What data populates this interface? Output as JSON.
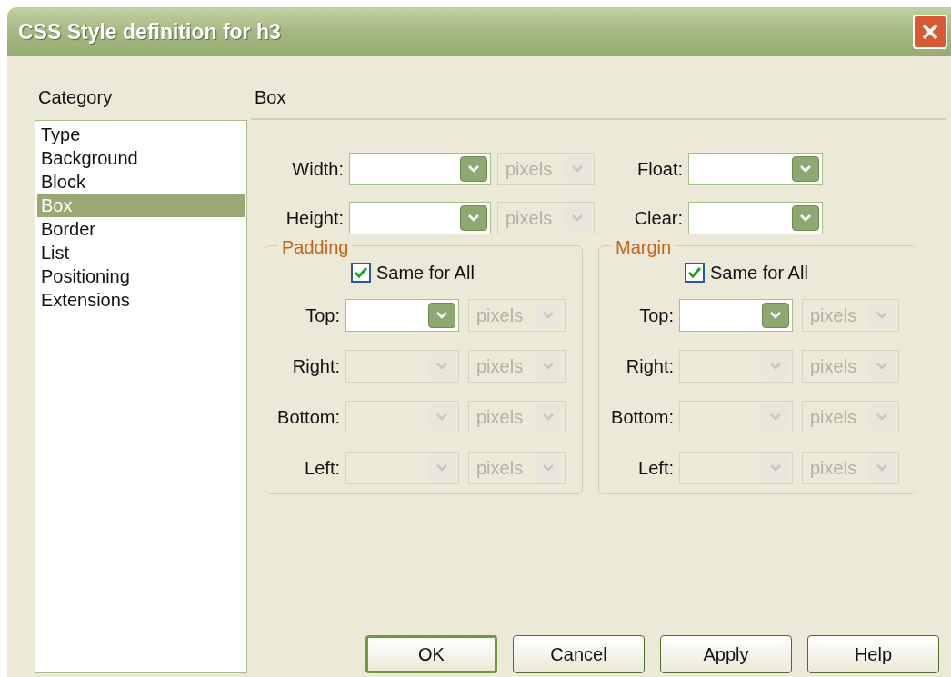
{
  "window": {
    "title": "CSS Style definition for h3"
  },
  "category": {
    "label": "Category",
    "items": [
      {
        "label": "Type",
        "selected": false
      },
      {
        "label": "Background",
        "selected": false
      },
      {
        "label": "Block",
        "selected": false
      },
      {
        "label": "Box",
        "selected": true
      },
      {
        "label": "Border",
        "selected": false
      },
      {
        "label": "List",
        "selected": false
      },
      {
        "label": "Positioning",
        "selected": false
      },
      {
        "label": "Extensions",
        "selected": false
      }
    ]
  },
  "panel": {
    "title": "Box",
    "left_fields": [
      {
        "label": "Width:",
        "disabled": false,
        "unit": "pixels"
      },
      {
        "label": "Height:",
        "disabled": false,
        "unit": "pixels"
      }
    ],
    "right_fields": [
      {
        "label": "Float:",
        "disabled": false
      },
      {
        "label": "Clear:",
        "disabled": false
      }
    ],
    "groups": [
      {
        "title": "Padding",
        "same_for_all": {
          "label": "Same for All",
          "checked": true
        },
        "fields": [
          {
            "label": "Top:",
            "disabled": false,
            "unit": "pixels"
          },
          {
            "label": "Right:",
            "disabled": true,
            "unit": "pixels"
          },
          {
            "label": "Bottom:",
            "disabled": true,
            "unit": "pixels"
          },
          {
            "label": "Left:",
            "disabled": true,
            "unit": "pixels"
          }
        ]
      },
      {
        "title": "Margin",
        "same_for_all": {
          "label": "Same for All",
          "checked": true
        },
        "fields": [
          {
            "label": "Top:",
            "disabled": false,
            "unit": "pixels"
          },
          {
            "label": "Right:",
            "disabled": true,
            "unit": "pixels"
          },
          {
            "label": "Bottom:",
            "disabled": true,
            "unit": "pixels"
          },
          {
            "label": "Left:",
            "disabled": true,
            "unit": "pixels"
          }
        ]
      }
    ]
  },
  "buttons": [
    {
      "label": "OK",
      "default": true
    },
    {
      "label": "Cancel",
      "default": false
    },
    {
      "label": "Apply",
      "default": false
    },
    {
      "label": "Help",
      "default": false
    }
  ]
}
